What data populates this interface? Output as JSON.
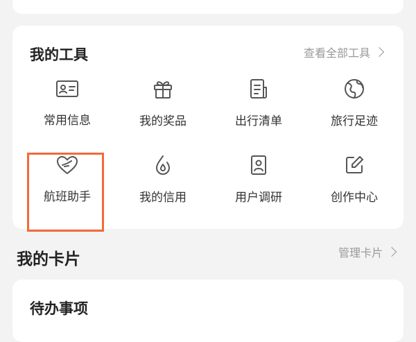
{
  "tools_section": {
    "title": "我的工具",
    "view_all_label": "查看全部工具",
    "items": [
      {
        "label": "常用信息",
        "icon": "id-card-icon"
      },
      {
        "label": "我的奖品",
        "icon": "gift-icon"
      },
      {
        "label": "出行清单",
        "icon": "checklist-icon"
      },
      {
        "label": "旅行足迹",
        "icon": "globe-icon"
      },
      {
        "label": "航班助手",
        "icon": "heart-plane-icon"
      },
      {
        "label": "我的信用",
        "icon": "droplet-icon"
      },
      {
        "label": "用户调研",
        "icon": "survey-icon"
      },
      {
        "label": "创作中心",
        "icon": "edit-icon"
      }
    ]
  },
  "cards_section": {
    "title": "我的卡片",
    "manage_label": "管理卡片"
  },
  "todo_section": {
    "title": "待办事项"
  },
  "colors": {
    "background": "#f3f3f3",
    "card": "#ffffff",
    "highlight": "#f26a3a",
    "muted_text": "#999999"
  }
}
